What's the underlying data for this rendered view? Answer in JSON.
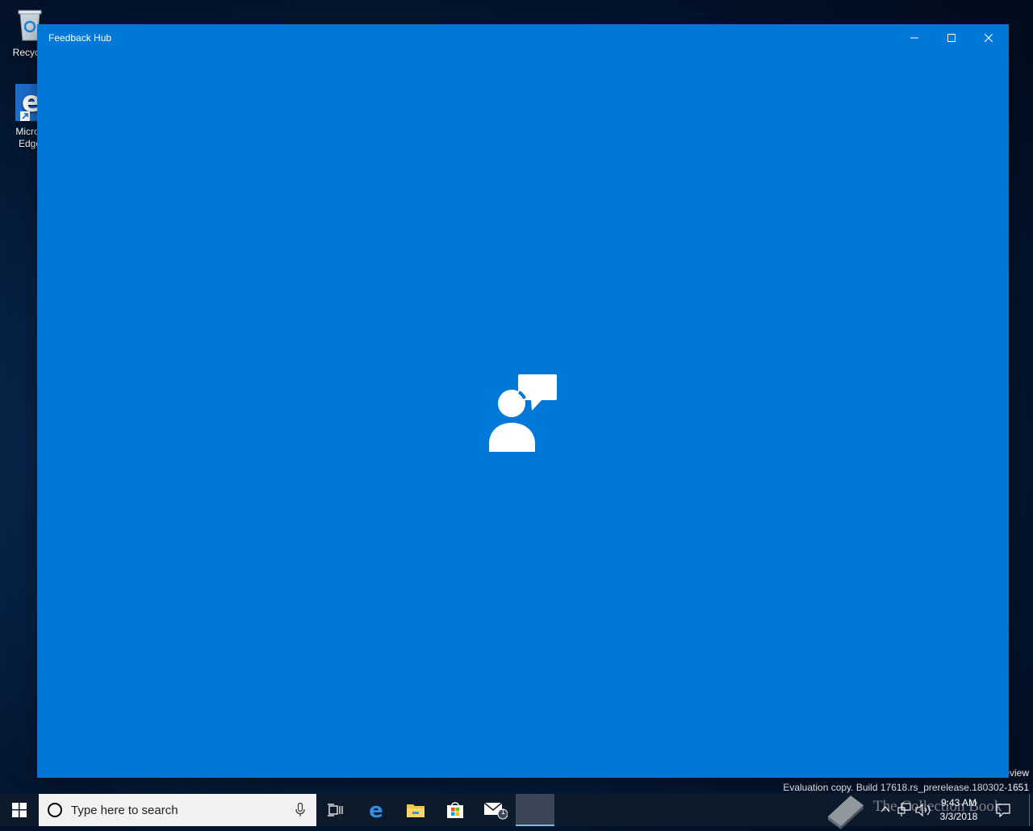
{
  "desktop": {
    "icons": [
      {
        "label": "Recycle",
        "icon": "recycle-bin-icon"
      },
      {
        "label_line1": "Micros",
        "label_line2": "Edge",
        "icon": "edge-icon"
      }
    ]
  },
  "window": {
    "title": "Feedback Hub",
    "splash_icon": "feedback-person-speech-icon",
    "colors": {
      "background": "#0078d7"
    }
  },
  "watermark": {
    "line1": "eview",
    "line2": "Evaluation copy. Build 17618.rs_prerelease.180302-1651"
  },
  "taskbar": {
    "search_placeholder": "Type here to search",
    "apps": [
      "task-view-icon",
      "edge-icon",
      "file-explorer-icon",
      "store-icon",
      "mail-icon"
    ],
    "mail_badge": "1",
    "overlay_text": "The Collection Book",
    "clock": {
      "time": "9:43 AM",
      "date": "3/3/2018"
    }
  }
}
